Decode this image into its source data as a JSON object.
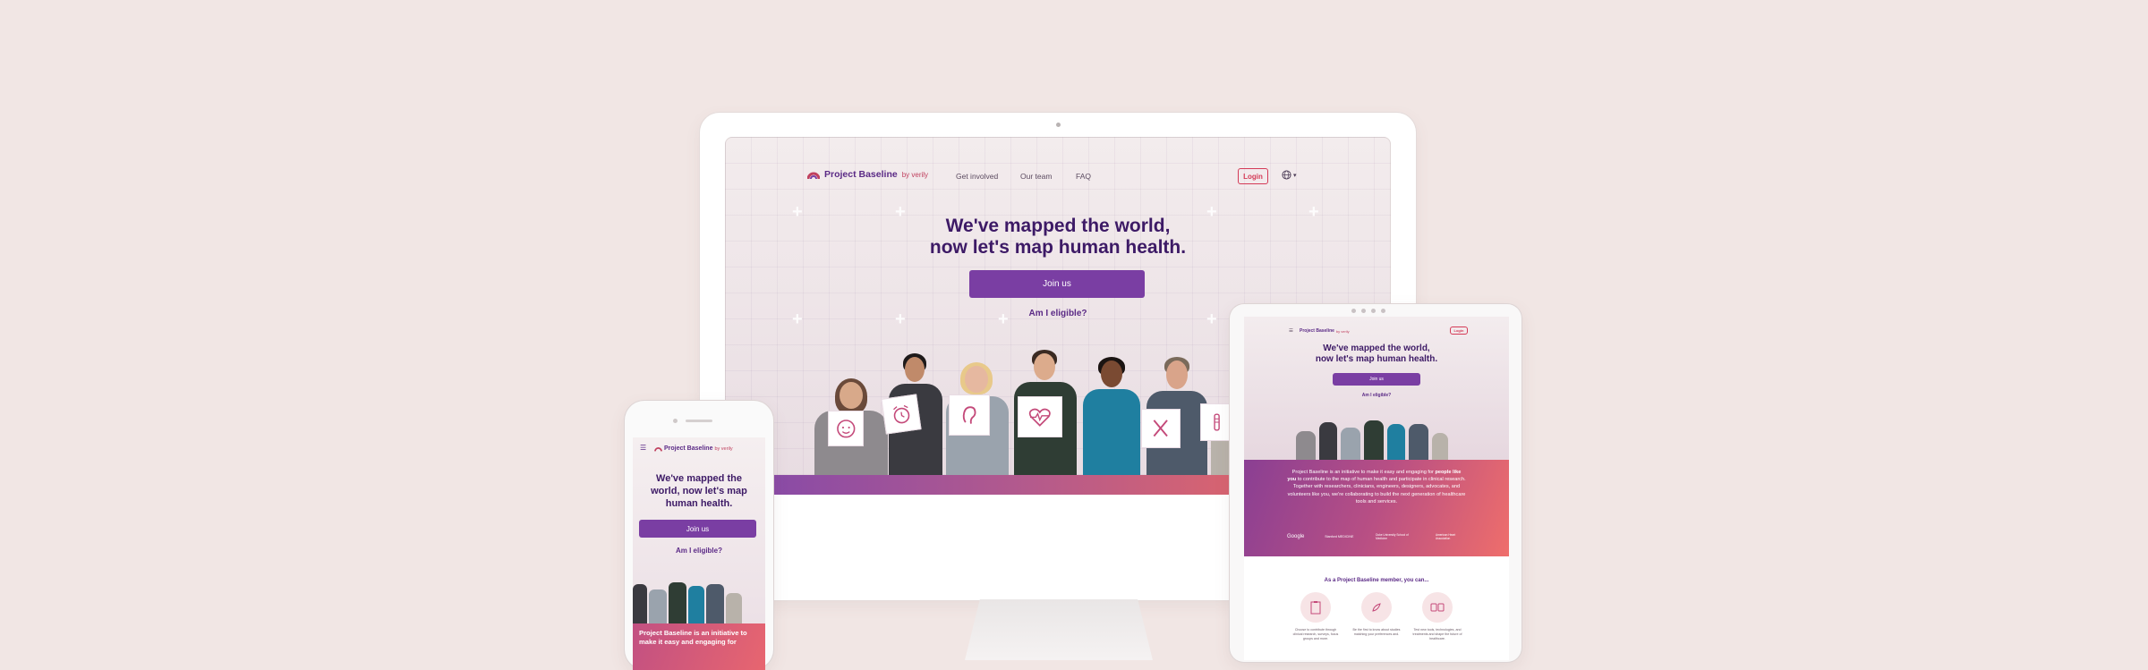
{
  "brand": {
    "name": "Project Baseline",
    "by": "by verily"
  },
  "nav": {
    "items": [
      "Get involved",
      "Our team",
      "FAQ"
    ],
    "login": "Login"
  },
  "hero": {
    "title_line1": "We've mapped the world,",
    "title_line2": "now let's map human health.",
    "join": "Join us",
    "eligible": "Am I eligible?"
  },
  "tablet": {
    "title_line1": "We've mapped the world,",
    "title_line2": "now let's map human health.",
    "join": "Join us",
    "eligible": "Am I eligible?",
    "login": "Login",
    "intro_pre": "Project Baseline is an initiative to make it easy and engaging for ",
    "intro_bold": "people like you",
    "intro_post": " to contribute to the map of human health and participate in clinical research. Together with researchers, clinicians, engineers, designers, advocates, and volunteers like you, we're collaborating to build the next generation of healthcare tools and services.",
    "partners": [
      "Google",
      "Stanford MEDICINE",
      "Duke University School of Medicine",
      "American Heart Association"
    ],
    "member_heading": "As a Project Baseline member, you can...",
    "benefits": [
      "Choose to contribute through clinical research, surveys, focus groups and more.",
      "Be the first to know about studies matching your preferences and.",
      "Test new tools, technologies, and treatments and shape the future of healthcare."
    ]
  },
  "phone": {
    "title_line1": "We've mapped the",
    "title_line2": "world, now let's map",
    "title_line3": "human health.",
    "join": "Join us",
    "eligible": "Am I eligible?",
    "intro_line1": "Project Baseline is an initiative to",
    "intro_line2": "make it easy and engaging for"
  },
  "colors": {
    "background": "#f1e6e4",
    "brand_purple": "#5b2a86",
    "button_purple": "#7a3ea3",
    "accent_red": "#d43a57",
    "heading_purple": "#3d1a66"
  },
  "icons": {
    "logo": "baseline-logo-icon",
    "globe": "globe-icon",
    "menu": "hamburger-menu-icon"
  }
}
